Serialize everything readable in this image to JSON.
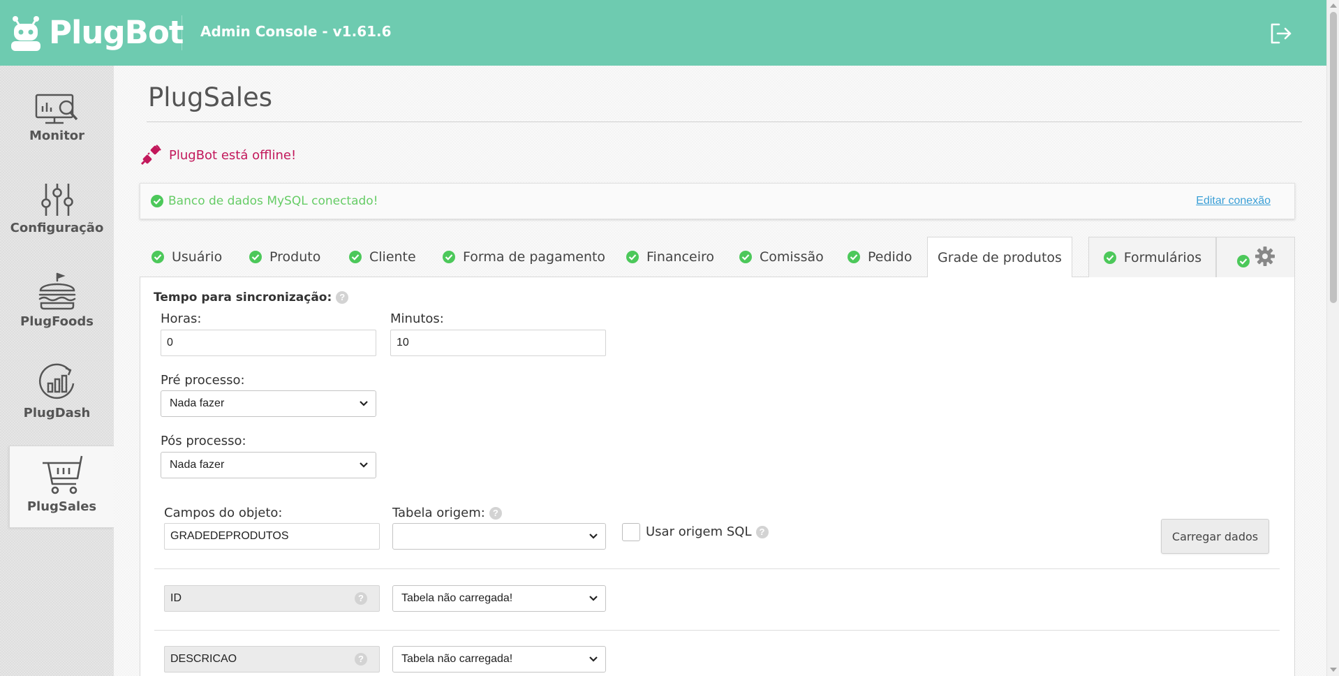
{
  "header": {
    "logo_text": "PlugBot",
    "admin_console": "Admin Console - v1.61.6",
    "logout_icon": "logout-icon",
    "bg_color": "#6ecbb0"
  },
  "sidebar": {
    "items": [
      {
        "label": "Monitor",
        "icon": "monitor-icon"
      },
      {
        "label": "Configuração",
        "icon": "sliders-icon"
      },
      {
        "label": "PlugFoods",
        "icon": "burger-icon"
      },
      {
        "label": "PlugDash",
        "icon": "chart-circle-icon"
      },
      {
        "label": "PlugSales",
        "icon": "cart-icon",
        "active": true
      }
    ]
  },
  "page": {
    "title": "PlugSales",
    "offline_message": "PlugBot está offline!",
    "db_status": "Banco de dados MySQL conectado!",
    "db_edit_link": "Editar conexão"
  },
  "tabs": [
    {
      "label": "Usuário",
      "status": "ok"
    },
    {
      "label": "Produto",
      "status": "ok"
    },
    {
      "label": "Cliente",
      "status": "ok"
    },
    {
      "label": "Forma de pagamento",
      "status": "ok"
    },
    {
      "label": "Financeiro",
      "status": "ok"
    },
    {
      "label": "Comissão",
      "status": "ok"
    },
    {
      "label": "Pedido",
      "status": "ok"
    },
    {
      "label": "Grade de produtos",
      "active": true
    },
    {
      "label": "Formulários",
      "status": "ok"
    },
    {
      "label": "",
      "icon": "gear-icon",
      "status": "ok"
    }
  ],
  "form": {
    "sync_time_label": "Tempo para sincronização:",
    "hours_label": "Horas:",
    "hours_value": "0",
    "minutes_label": "Minutos:",
    "minutes_value": "10",
    "pre_process_label": "Pré processo:",
    "pre_process_value": "Nada fazer",
    "post_process_label": "Pós processo:",
    "post_process_value": "Nada fazer",
    "object_fields_label": "Campos do objeto:",
    "object_fields_value": "GRADEDEPRODUTOS",
    "source_table_label": "Tabela origem:",
    "source_table_value": "",
    "use_sql_label": "Usar origem SQL",
    "use_sql_checked": false,
    "load_button": "Carregar dados",
    "help_glyph": "?"
  },
  "fields": [
    {
      "name": "ID",
      "mapping": "Tabela não carregada!"
    },
    {
      "name": "DESCRICAO",
      "mapping": "Tabela não carregada!"
    }
  ],
  "colors": {
    "accent": "#6ecbb0",
    "success": "#4cc85a",
    "offline": "#c2185b",
    "link": "#3a9fd6"
  }
}
